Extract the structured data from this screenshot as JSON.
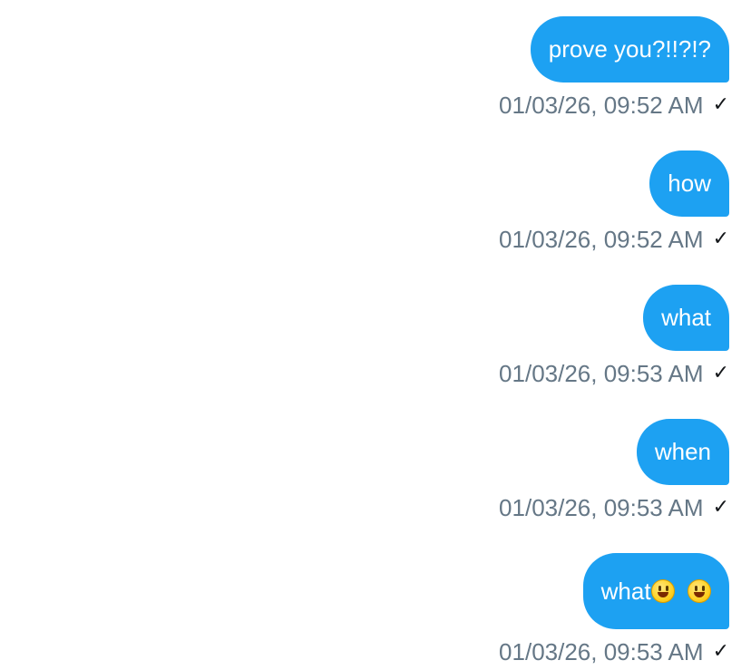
{
  "messages": [
    {
      "text": "prove you?!!?!?",
      "timestamp": "01/03/26, 09:52 AM",
      "status_icon": "single-check"
    },
    {
      "text": "how",
      "timestamp": "01/03/26, 09:52 AM",
      "status_icon": "single-check"
    },
    {
      "text": "what",
      "timestamp": "01/03/26, 09:53 AM",
      "status_icon": "single-check"
    },
    {
      "text": "when",
      "timestamp": "01/03/26, 09:53 AM",
      "status_icon": "single-check"
    },
    {
      "text": "what",
      "emoji_1": "grinning-face-emoji",
      "emoji_2": "grinning-face-emoji",
      "timestamp": "01/03/26, 09:53 AM",
      "status_icon": "single-check"
    }
  ],
  "check_glyph": "✓",
  "colors": {
    "bubble": "#1da1f2",
    "bubble_text": "#ffffff",
    "timestamp": "#657786",
    "check": "#14171a",
    "background": "#ffffff"
  }
}
